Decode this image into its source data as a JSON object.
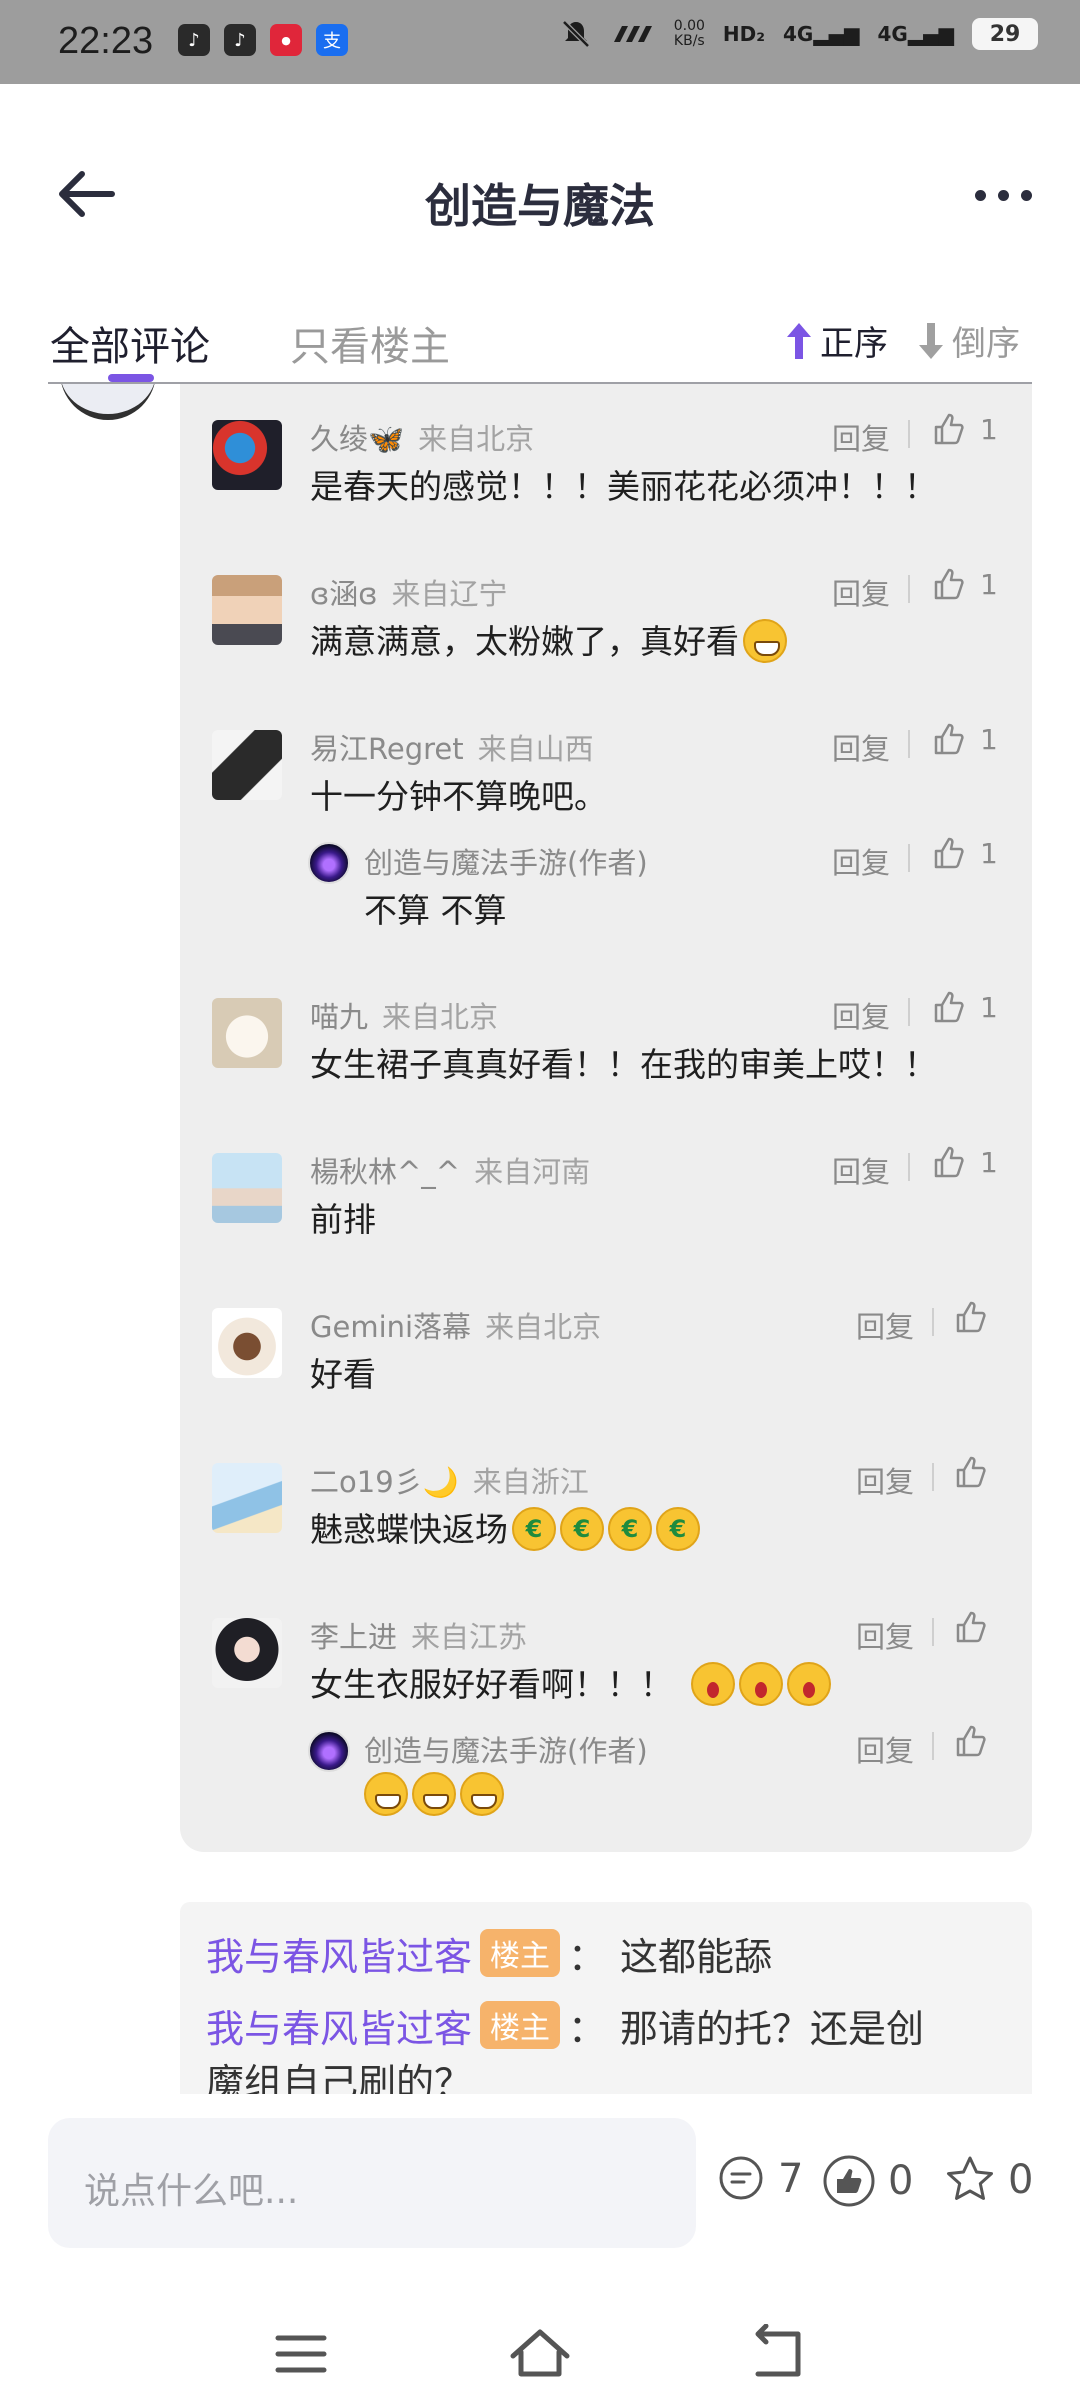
{
  "status_bar": {
    "time": "22:23",
    "speed_top": "0.00",
    "speed_bottom": "KB/s",
    "network1": "4G",
    "network2": "4G",
    "battery": "29"
  },
  "header": {
    "title": "创造与魔法"
  },
  "tabs": {
    "all": "全部评论",
    "owner_only": "只看楼主",
    "sort_asc": "正序",
    "sort_desc": "倒序"
  },
  "comments": [
    {
      "name": "久绫🦋",
      "location": "来自北京",
      "text": "是春天的感觉！！！美丽花花必须冲！！！",
      "reply": "回复",
      "likes": "1"
    },
    {
      "name": "ɞ涵ɞ",
      "location": "来自辽宁",
      "text": "满意满意，太粉嫩了，真好看",
      "reply": "回复",
      "likes": "1"
    },
    {
      "name": "易江Regret",
      "location": "来自山西",
      "text": "十一分钟不算晚吧。",
      "reply": "回复",
      "likes": "1",
      "sub": {
        "name": "创造与魔法手游(作者)",
        "text": "不算 不算",
        "reply": "回复",
        "likes": "1"
      }
    },
    {
      "name": "喵九",
      "location": "来自北京",
      "text": "女生裙子真真好看！！在我的审美上哎！！",
      "reply": "回复",
      "likes": "1"
    },
    {
      "name": "楊秋林^_^",
      "location": "来自河南",
      "text": "前排",
      "reply": "回复",
      "likes": "1"
    },
    {
      "name": "Gemini落幕",
      "location": "来自北京",
      "text": "好看",
      "reply": "回复",
      "likes": ""
    },
    {
      "name": "二o19彡🌙",
      "location": "来自浙江",
      "text": "魅惑蝶快返场",
      "reply": "回复",
      "likes": ""
    },
    {
      "name": "李上进",
      "location": "来自江苏",
      "text": "女生衣服好好看啊！！！",
      "reply": "回复",
      "likes": "",
      "sub": {
        "name": "创造与魔法手游(作者)",
        "text": "",
        "reply": "回复",
        "likes": ""
      }
    }
  ],
  "quotes": [
    {
      "user": "我与春风皆过客",
      "tag": "楼主",
      "colon": "：",
      "text": "这都能舔"
    },
    {
      "user": "我与春风皆过客",
      "tag": "楼主",
      "colon": "：",
      "text": "那请的托？还是创"
    },
    {
      "continuation": "魔组自己刷的？"
    }
  ],
  "bottom_bar": {
    "input_placeholder": "说点什么吧...",
    "comment_count": "7",
    "like_count": "0",
    "fav_count": "0"
  },
  "colors": {
    "accent": "#7b55e4",
    "owner_tag": "#f6b36b",
    "status_bar": "#9d9d9d",
    "reply_box": "#eeeeee"
  }
}
